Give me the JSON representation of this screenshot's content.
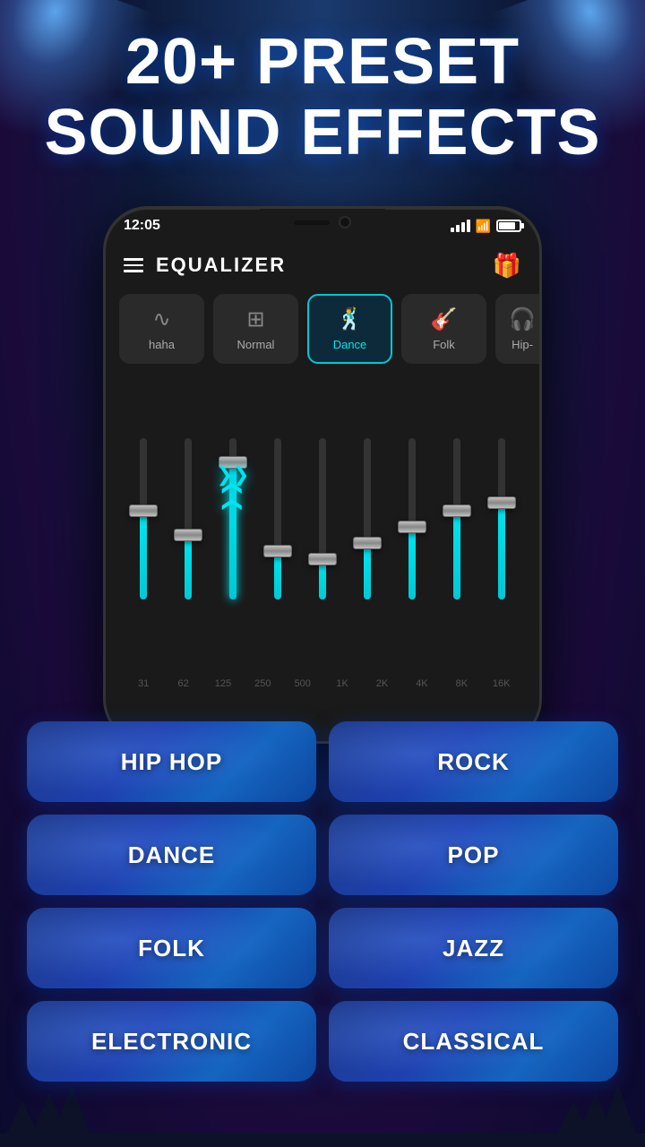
{
  "background": {
    "color_main": "#0a0a2e",
    "color_accent": "#1a3a6e"
  },
  "title": {
    "line1": "20+ PRESET",
    "line2": "SOUND EFFECTS"
  },
  "phone": {
    "status_time": "12:05",
    "app_title": "EQUALIZER",
    "gift_icon": "🎁"
  },
  "presets": [
    {
      "id": "haha",
      "label": "haha",
      "icon": "∿",
      "active": false
    },
    {
      "id": "normal",
      "label": "Normal",
      "icon": "⊞",
      "active": false
    },
    {
      "id": "dance",
      "label": "Dance",
      "icon": "🕺",
      "active": true
    },
    {
      "id": "folk",
      "label": "Folk",
      "icon": "♪",
      "active": false
    },
    {
      "id": "hiphop",
      "label": "Hip-",
      "icon": "🎧",
      "active": false
    }
  ],
  "sliders": [
    {
      "id": "s1",
      "fill_pct": 55,
      "thumb_pct": 55
    },
    {
      "id": "s2",
      "fill_pct": 40,
      "thumb_pct": 40
    },
    {
      "id": "s3",
      "fill_pct": 85,
      "thumb_pct": 85
    },
    {
      "id": "s4",
      "fill_pct": 30,
      "thumb_pct": 30
    },
    {
      "id": "s5",
      "fill_pct": 25,
      "thumb_pct": 25
    },
    {
      "id": "s6",
      "fill_pct": 35,
      "thumb_pct": 35
    },
    {
      "id": "s7",
      "fill_pct": 45,
      "thumb_pct": 45
    },
    {
      "id": "s8",
      "fill_pct": 50,
      "thumb_pct": 50
    },
    {
      "id": "s9",
      "fill_pct": 55,
      "thumb_pct": 55
    }
  ],
  "freq_labels": [
    "31",
    "62",
    "125",
    "250",
    "500",
    "1K",
    "2K",
    "4K",
    "8K",
    "16K"
  ],
  "genres": [
    {
      "id": "hip-hop",
      "label": "HIP HOP"
    },
    {
      "id": "rock",
      "label": "ROCK"
    },
    {
      "id": "dance",
      "label": "DANCE"
    },
    {
      "id": "pop",
      "label": "POP"
    },
    {
      "id": "folk",
      "label": "FOLK"
    },
    {
      "id": "jazz",
      "label": "JAZZ"
    },
    {
      "id": "electronic",
      "label": "ELECTRONIC"
    },
    {
      "id": "classical",
      "label": "CLASSICAL"
    }
  ]
}
